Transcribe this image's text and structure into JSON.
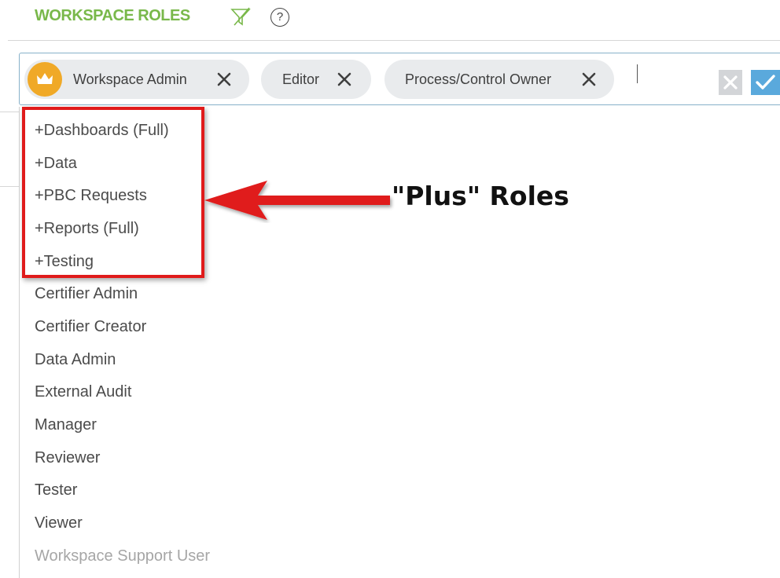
{
  "header": {
    "title": "WORKSPACE ROLES",
    "filter_icon": "filter-off-icon",
    "help_icon": "help-icon",
    "help_glyph": "?"
  },
  "selected_roles": [
    {
      "label": "Workspace Admin",
      "icon": "crown-icon",
      "remove_icon": "close-icon"
    },
    {
      "label": "Editor",
      "remove_icon": "close-icon"
    },
    {
      "label": "Process/Control Owner",
      "remove_icon": "close-icon"
    }
  ],
  "actions": {
    "cancel_icon": "close-icon",
    "confirm_icon": "check-icon",
    "cancel_color": "#d3d5d8",
    "confirm_color": "#5aa9dc"
  },
  "options": [
    {
      "label": "+Dashboards (Full)"
    },
    {
      "label": "+Data"
    },
    {
      "label": "+PBC Requests"
    },
    {
      "label": "+Reports (Full)"
    },
    {
      "label": "+Testing"
    },
    {
      "label": "Certifier Admin"
    },
    {
      "label": "Certifier Creator"
    },
    {
      "label": "Data Admin"
    },
    {
      "label": "External Audit"
    },
    {
      "label": "Manager"
    },
    {
      "label": "Reviewer"
    },
    {
      "label": "Tester"
    },
    {
      "label": "Viewer"
    },
    {
      "label": "Workspace Support User",
      "disabled": true
    }
  ],
  "annotation": {
    "label": "\"Plus\" Roles",
    "color": "#e01b1b"
  },
  "colors": {
    "title_green": "#79b84a",
    "crown_orange": "#f0a927",
    "chip_bg": "#e9ebed",
    "input_border": "#87b1c9"
  }
}
